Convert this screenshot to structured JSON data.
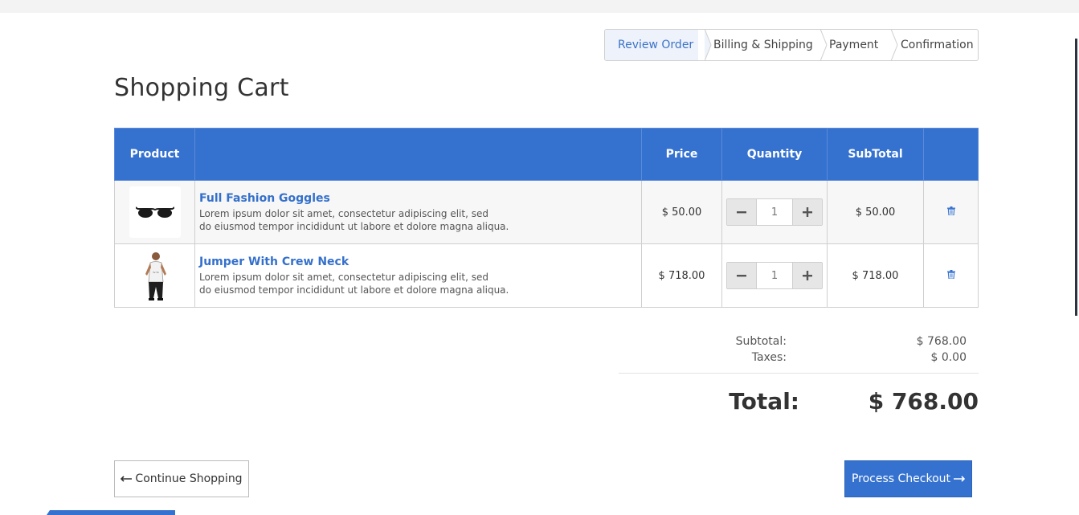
{
  "steps": [
    {
      "label": "Review Order"
    },
    {
      "label": "Billing & Shipping"
    },
    {
      "label": "Payment"
    },
    {
      "label": "Confirmation"
    }
  ],
  "page_title": "Shopping Cart",
  "table": {
    "headers": [
      "Product",
      "",
      "Price",
      "Quantity",
      "SubTotal",
      ""
    ],
    "rows": [
      {
        "name": "Full Fashion Goggles",
        "desc_line1": "Lorem ipsum dolor sit amet, consectetur adipiscing elit, sed",
        "desc_line2": "do eiusmod tempor incididunt ut labore et dolore magna aliqua.",
        "price": "$ 50.00",
        "quantity": "1",
        "subtotal": "$ 50.00",
        "image_icon": "sunglasses-icon"
      },
      {
        "name": "Jumper With Crew Neck",
        "desc_line1": "Lorem ipsum dolor sit amet, consectetur adipiscing elit, sed",
        "desc_line2": "do eiusmod tempor incididunt ut labore et dolore magna aliqua.",
        "price": "$ 718.00",
        "quantity": "1",
        "subtotal": "$ 718.00",
        "image_icon": "tank-top-model-icon"
      }
    ]
  },
  "summary": {
    "subtotal_label": "Subtotal:",
    "subtotal_value": "$ 768.00",
    "taxes_label": "Taxes:",
    "taxes_value": "$ 0.00",
    "total_label": "Total:",
    "total_value": "$ 768.00"
  },
  "buttons": {
    "continue_label": "Continue Shopping",
    "checkout_label": "Process Checkout"
  },
  "colors": {
    "primary": "#3572d0",
    "link": "#3470cb",
    "active_step_bg": "#eef2fa"
  }
}
